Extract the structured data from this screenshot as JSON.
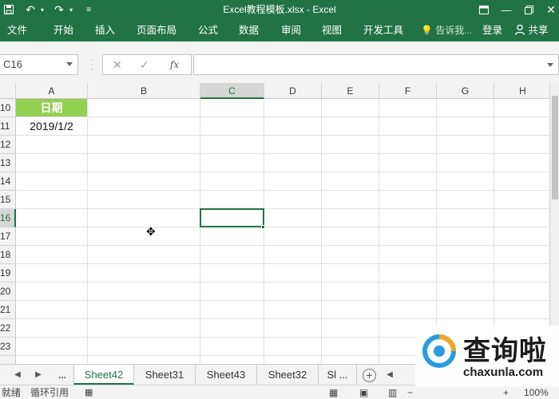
{
  "window": {
    "title": "Excel教程模板.xlsx - Excel",
    "colors": {
      "brand": "#217346",
      "header_fill": "#92D050"
    }
  },
  "quick_access": {
    "icons": [
      "save-icon",
      "undo-icon",
      "redo-icon",
      "customize-icon"
    ]
  },
  "ribbon": {
    "tabs": [
      "文件",
      "开始",
      "插入",
      "页面布局",
      "公式",
      "数据",
      "审阅",
      "视图",
      "开发工具"
    ],
    "tell_me": "告诉我...",
    "login": "登录",
    "share": "共享"
  },
  "formula_bar": {
    "name_box": "C16",
    "fx_label": "fx",
    "formula_value": ""
  },
  "grid": {
    "columns": [
      "A",
      "B",
      "C",
      "D",
      "E",
      "F",
      "G",
      "H"
    ],
    "selected_column": "C",
    "rows": [
      "10",
      "11",
      "12",
      "13",
      "14",
      "15",
      "16",
      "17",
      "18",
      "19",
      "20",
      "21",
      "22",
      "23"
    ],
    "selected_row": "16",
    "cells": {
      "A10": "日期",
      "A11": "2019/1/2"
    },
    "active_cell": "C16"
  },
  "sheets": {
    "nav_more": "...",
    "tabs": [
      "Sheet42",
      "Sheet31",
      "Sheet43",
      "Sheet32",
      "Sl ..."
    ],
    "active": "Sheet42"
  },
  "status": {
    "ready": "就绪",
    "circular": "循环引用",
    "zoom": "100%"
  },
  "watermark": {
    "text": "查询啦",
    "url": "chaxunla.com"
  }
}
